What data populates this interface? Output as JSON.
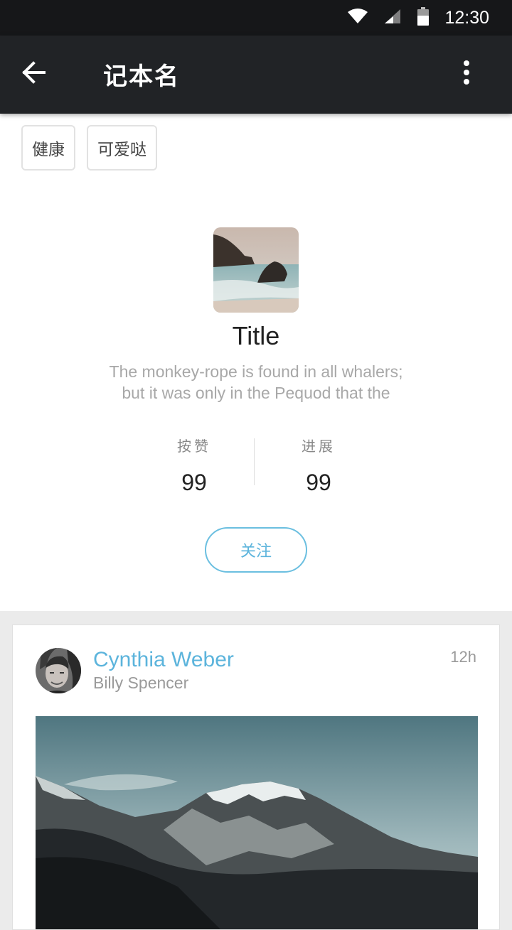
{
  "status_bar": {
    "time": "12:30"
  },
  "app_bar": {
    "title": "记本名"
  },
  "tags": [
    "健康",
    "可爱哒"
  ],
  "notebook": {
    "title": "Title",
    "description_line1": "The monkey-rope is found in all whalers;",
    "description_line2": "but it was only in the Pequod that the"
  },
  "stats": {
    "likes": {
      "label": "按赞",
      "value": "99"
    },
    "progress": {
      "label": "进展",
      "value": "99"
    }
  },
  "follow_button": {
    "label": "关注"
  },
  "feed": {
    "author": "Cynthia Weber",
    "subtitle": "Billy Spencer",
    "time": "12h"
  },
  "colors": {
    "accent": "#5cb4dc",
    "app_bar": "#212326",
    "status_bar": "#161719"
  }
}
